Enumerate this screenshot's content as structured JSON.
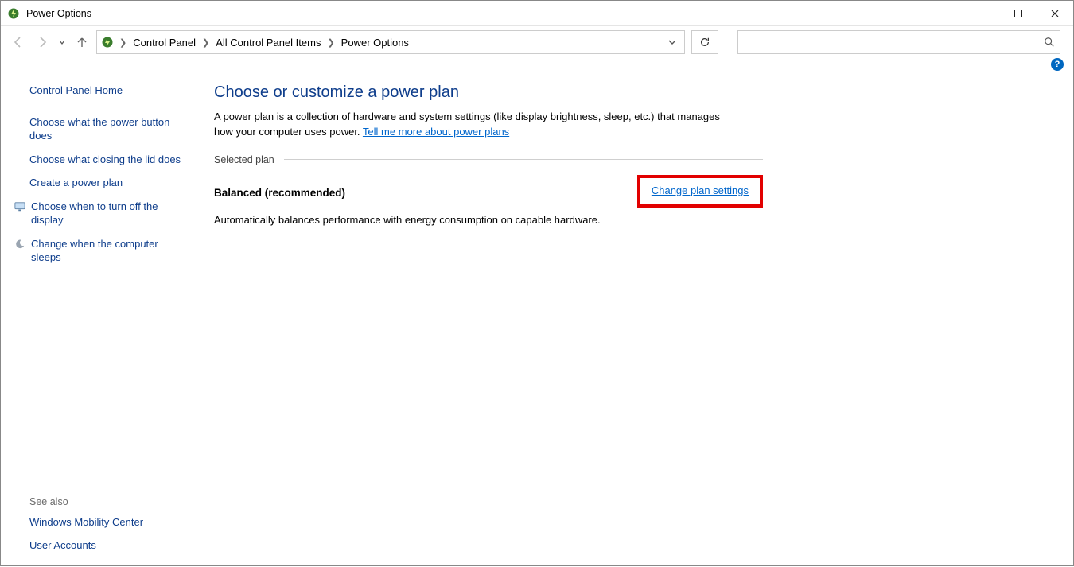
{
  "window": {
    "title": "Power Options"
  },
  "breadcrumb": {
    "items": [
      "Control Panel",
      "All Control Panel Items",
      "Power Options"
    ]
  },
  "sidebar": {
    "home": "Control Panel Home",
    "links": [
      "Choose what the power button does",
      "Choose what closing the lid does",
      "Create a power plan",
      "Choose when to turn off the display",
      "Change when the computer sleeps"
    ],
    "see_also_label": "See also",
    "see_also": [
      "Windows Mobility Center",
      "User Accounts"
    ]
  },
  "main": {
    "heading": "Choose or customize a power plan",
    "desc_prefix": "A power plan is a collection of hardware and system settings (like display brightness, sleep, etc.) that manages how your computer uses power. ",
    "desc_link": "Tell me more about power plans",
    "section_legend": "Selected plan",
    "plan_name": "Balanced (recommended)",
    "change_link": "Change plan settings",
    "plan_desc": "Automatically balances performance with energy consumption on capable hardware."
  },
  "search": {
    "placeholder": ""
  }
}
